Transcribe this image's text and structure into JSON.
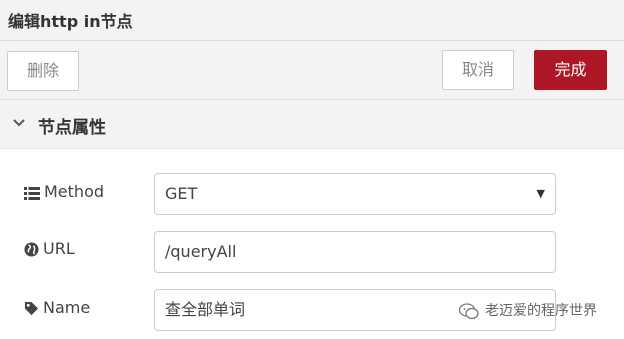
{
  "title": "编辑http in节点",
  "toolbar": {
    "delete_label": "删除",
    "cancel_label": "取消",
    "done_label": "完成"
  },
  "section": {
    "title": "节点属性"
  },
  "form": {
    "method": {
      "label": "Method",
      "value": "GET"
    },
    "url": {
      "label": "URL",
      "value": "/queryAll"
    },
    "name": {
      "label": "Name",
      "value": "查全部单词"
    }
  },
  "watermark": {
    "text": "老迈爱的程序世界"
  },
  "colors": {
    "primary_button": "#ad1625",
    "header_bg": "#f3f3f3"
  },
  "icons": [
    "chevron-down-icon",
    "list-icon",
    "globe-icon",
    "tag-icon",
    "wechat-icon"
  ]
}
